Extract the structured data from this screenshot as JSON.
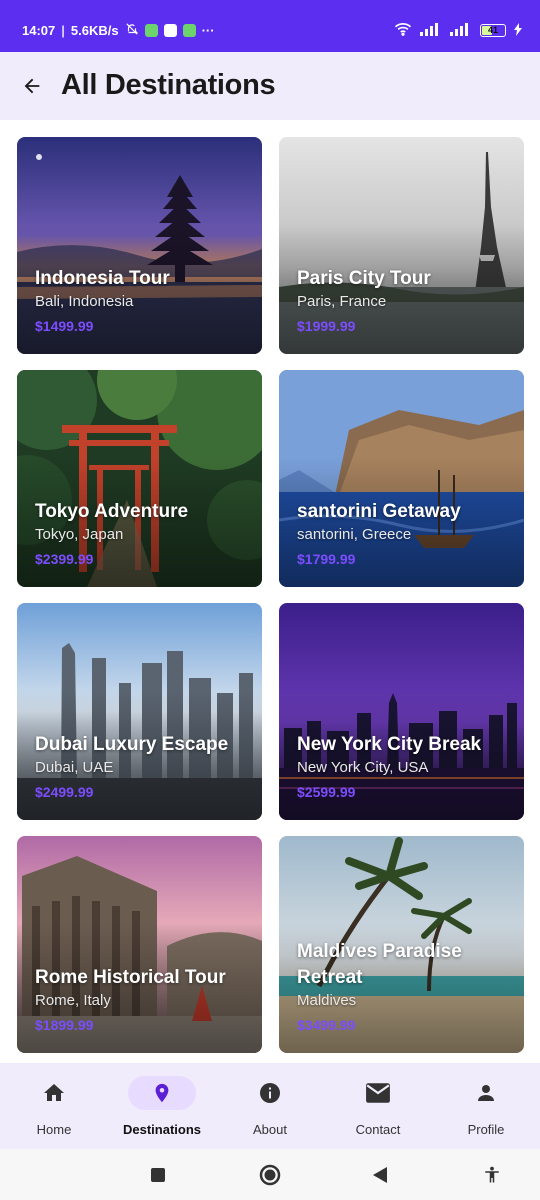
{
  "status_bar": {
    "time": "14:07",
    "network_speed": "5.6KB/s",
    "more": "···",
    "battery": "41"
  },
  "header": {
    "title": "All Destinations"
  },
  "destinations": [
    {
      "title": "Indonesia Tour",
      "location": "Bali, Indonesia",
      "price": "$1499.99"
    },
    {
      "title": "Paris City Tour",
      "location": "Paris, France",
      "price": "$1999.99"
    },
    {
      "title": "Tokyo Adventure",
      "location": "Tokyo, Japan",
      "price": "$2399.99"
    },
    {
      "title": "santorini Getaway",
      "location": "santorini, Greece",
      "price": "$1799.99"
    },
    {
      "title": "Dubai Luxury Escape",
      "location": "Dubai, UAE",
      "price": "$2499.99"
    },
    {
      "title": "New York City Break",
      "location": "New York City, USA",
      "price": "$2599.99"
    },
    {
      "title": "Rome Historical Tour",
      "location": "Rome, Italy",
      "price": "$1899.99"
    },
    {
      "title": "Maldives Paradise Retreat",
      "location": "Maldives",
      "price": "$3499.99"
    }
  ],
  "bottom_nav": {
    "items": [
      {
        "label": "Home",
        "icon": "home-icon"
      },
      {
        "label": "Destinations",
        "icon": "location-pin-icon",
        "active": true
      },
      {
        "label": "About",
        "icon": "info-icon"
      },
      {
        "label": "Contact",
        "icon": "mail-icon"
      },
      {
        "label": "Profile",
        "icon": "person-icon"
      }
    ]
  },
  "colors": {
    "status_bar": "#5b2ef0",
    "header_bg": "#f1ecfb",
    "price": "#7c4dff",
    "nav_active_pill": "#e7dcff",
    "nav_active_icon": "#5b1fd6"
  }
}
